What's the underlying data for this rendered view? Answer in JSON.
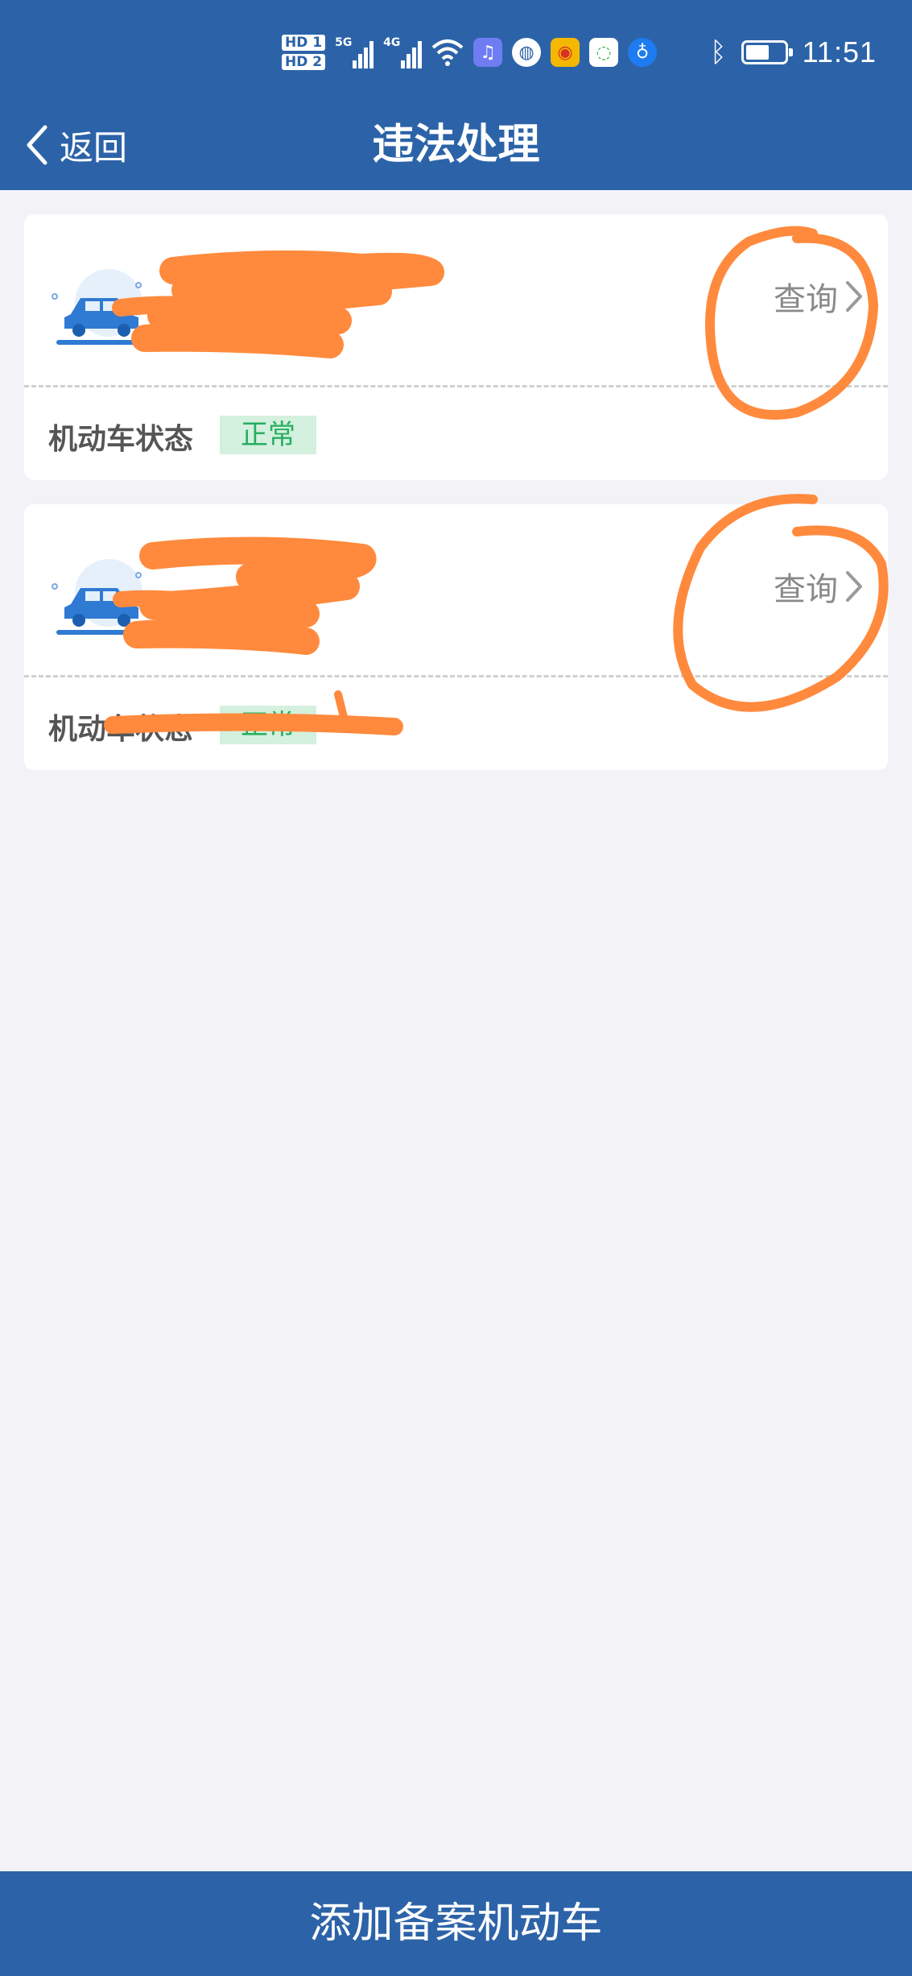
{
  "status_bar": {
    "sim1": "HD 1",
    "sim2": "HD 2",
    "network1": "5G",
    "network2": "4G",
    "time": "11:51"
  },
  "nav": {
    "back_label": "返回",
    "title": "违法处理"
  },
  "vehicles": [
    {
      "plate": "",
      "query_label": "查询",
      "status_label": "机动车状态",
      "status_value": "正常"
    },
    {
      "plate": "",
      "query_label": "查询",
      "status_label": "机动车状态",
      "status_value": "正常"
    }
  ],
  "footer": {
    "add_button_label": "添加备案机动车"
  },
  "colors": {
    "primary": "#2c63a8",
    "background": "#f2f2f7",
    "status_ok_bg": "#d4f0de",
    "status_ok_text": "#27ae60",
    "annotation": "#ff8a3d"
  },
  "icons": [
    "back-chevron-icon",
    "car-icon",
    "chevron-right-icon",
    "bluetooth-icon",
    "battery-icon",
    "wifi-icon"
  ]
}
